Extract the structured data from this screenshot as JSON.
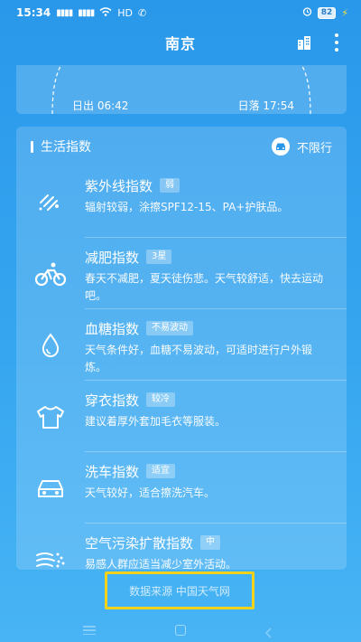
{
  "status_bar": {
    "time": "15:34",
    "signal_text": "HD",
    "battery": "82"
  },
  "header": {
    "title": "南京"
  },
  "sun": {
    "sunrise": "日出 06:42",
    "sunset": "日落 17:54"
  },
  "life_index": {
    "title": "生活指数",
    "restriction": "不限行",
    "items": [
      {
        "name": "紫外线指数",
        "badge": "弱",
        "desc": "辐射较弱，涂擦SPF12-15、PA+护肤品。",
        "icon": "uv-icon"
      },
      {
        "name": "减肥指数",
        "badge": "3星",
        "desc": "春天不减肥，夏天徒伤悲。天气较舒适，快去运动吧。",
        "icon": "cycling-icon"
      },
      {
        "name": "血糖指数",
        "badge": "不易波动",
        "desc": "天气条件好，血糖不易波动，可适时进行户外锻炼。",
        "icon": "drop-icon"
      },
      {
        "name": "穿衣指数",
        "badge": "较冷",
        "desc": "建议着厚外套加毛衣等服装。",
        "icon": "shirt-icon"
      },
      {
        "name": "洗车指数",
        "badge": "适宜",
        "desc": "天气较好，适合擦洗汽车。",
        "icon": "car-icon"
      },
      {
        "name": "空气污染扩散指数",
        "badge": "中",
        "desc": "易感人群应适当减少室外活动。",
        "icon": "wind-icon"
      }
    ]
  },
  "footer": {
    "source": "数据来源 中国天气网",
    "highlight_color": "#f2d21b"
  },
  "colors": {
    "background_top": "#2a98ea",
    "background_bottom": "#48b4f5"
  }
}
